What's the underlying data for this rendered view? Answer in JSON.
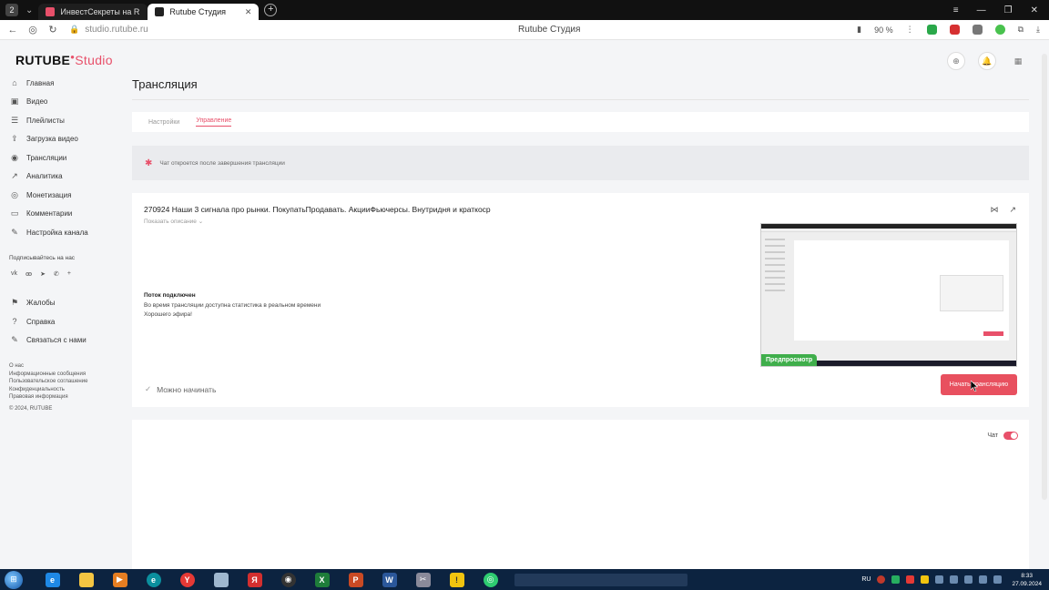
{
  "browser": {
    "tab_counter": "2",
    "tabs": [
      {
        "title": "ИнвестСекреты на RUTUBE",
        "active": false
      },
      {
        "title": "Rutube Студия",
        "active": true
      }
    ],
    "url": "studio.rutube.ru",
    "center_title": "Rutube Студия",
    "zoom": "90 %"
  },
  "header": {
    "logo_main": "RUTUBE",
    "logo_sub": "Studio"
  },
  "sidebar": {
    "items": [
      {
        "label": "Главная",
        "icon": "home-icon"
      },
      {
        "label": "Видео",
        "icon": "video-icon"
      },
      {
        "label": "Плейлисты",
        "icon": "playlist-icon"
      },
      {
        "label": "Загрузка видео",
        "icon": "upload-icon"
      },
      {
        "label": "Трансляции",
        "icon": "broadcast-icon"
      },
      {
        "label": "Аналитика",
        "icon": "analytics-icon"
      },
      {
        "label": "Монетизация",
        "icon": "money-icon"
      },
      {
        "label": "Комментарии",
        "icon": "comments-icon"
      },
      {
        "label": "Настройка канала",
        "icon": "settings-icon"
      }
    ],
    "subscribe_label": "Подписывайтесь на нас",
    "links": [
      {
        "label": "Жалобы",
        "icon": "flag-icon"
      },
      {
        "label": "Справка",
        "icon": "help-icon"
      },
      {
        "label": "Связаться с нами",
        "icon": "contact-icon"
      }
    ],
    "footer": [
      "О нас",
      "Информационные сообщения",
      "Пользовательское соглашение",
      "Конфиденциальность",
      "Правовая информация",
      "© 2024, RUTUBE"
    ]
  },
  "main": {
    "title": "Трансляция",
    "tabs": [
      "Настройки",
      "Управление"
    ],
    "alert": "Чат откроется после завершения трансляции",
    "stream_title": "270924 Наши 3 сигнала про рынки. ПокупатьПродавать. АкцииФьючерсы. Внутридня и краткоср",
    "show_description": "Показать описание",
    "status_title": "Поток подключен",
    "status_line1": "Во время трансляции доступна статистика в реальном времени",
    "status_line2": "Хорошего эфира!",
    "ready_label": "Можно начинать",
    "preview_badge": "Предпросмотр",
    "start_button": "Начать трансляцию",
    "chat_label": "Чат"
  },
  "taskbar": {
    "lang": "RU",
    "time": "8:33",
    "date": "27.09.2024"
  }
}
